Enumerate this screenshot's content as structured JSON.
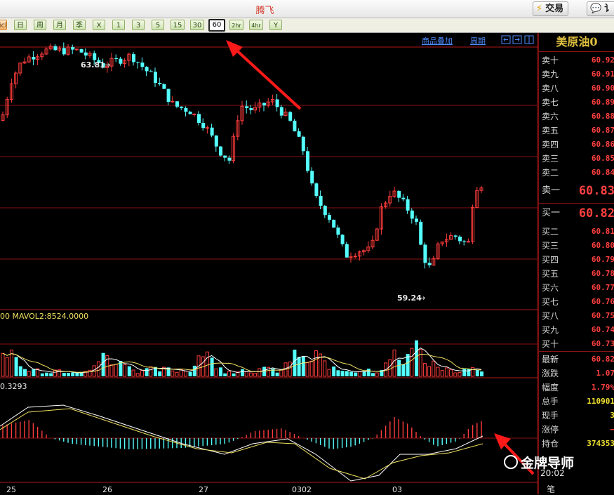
{
  "window": {
    "title": "腾飞",
    "trade_button": "交易",
    "chat_button": "讠"
  },
  "period_bar": {
    "buttons": [
      "lick",
      "日",
      "周",
      "月",
      "季",
      "X",
      "1",
      "3",
      "5",
      "15",
      "30",
      "60",
      "2hr",
      "4hr",
      "Y"
    ],
    "active": "60"
  },
  "chart_header": {
    "overlay_link": "商品叠加",
    "period_link": "周期"
  },
  "price_chart": {
    "high_label": "63.81",
    "low_label": "59.24",
    "colors": {
      "up": "#ff3c3c",
      "down": "#54ffff",
      "grid": "#8a1010",
      "background": "#000000"
    }
  },
  "volume_panel": {
    "label": "00  MAVOL2:8524.0000"
  },
  "macd_panel": {
    "label": "0.3293"
  },
  "x_axis": {
    "ticks": [
      "25",
      "26",
      "27",
      "0302",
      "03"
    ]
  },
  "quote_panel": {
    "symbol": "美原油0",
    "asks": [
      {
        "label": "卖十",
        "value": "60.92"
      },
      {
        "label": "卖九",
        "value": "60.91"
      },
      {
        "label": "卖八",
        "value": "60.90"
      },
      {
        "label": "卖七",
        "value": "60.89"
      },
      {
        "label": "卖六",
        "value": "60.88"
      },
      {
        "label": "卖五",
        "value": "60.87"
      },
      {
        "label": "卖四",
        "value": "60.86"
      },
      {
        "label": "卖三",
        "value": "60.85"
      },
      {
        "label": "卖二",
        "value": "60.84"
      },
      {
        "label": "卖一",
        "value": "60.83"
      }
    ],
    "bids": [
      {
        "label": "买一",
        "value": "60.82"
      },
      {
        "label": "买二",
        "value": "60.81"
      },
      {
        "label": "买三",
        "value": "60.80"
      },
      {
        "label": "买四",
        "value": "60.79"
      },
      {
        "label": "买五",
        "value": "60.78"
      },
      {
        "label": "买六",
        "value": "60.77"
      },
      {
        "label": "买七",
        "value": "60.76"
      },
      {
        "label": "买八",
        "value": "60.75"
      },
      {
        "label": "买九",
        "value": "60.74"
      },
      {
        "label": "买十",
        "value": "60.73"
      }
    ],
    "stats": [
      {
        "label": "最新",
        "value": "60.82"
      },
      {
        "label": "涨跌",
        "value": "1.07"
      },
      {
        "label": "幅度",
        "value": "1.79%"
      },
      {
        "label": "总手",
        "value": "110901"
      },
      {
        "label": "现手",
        "value": "3"
      },
      {
        "label": "涨停",
        "value": "—"
      },
      {
        "label": "持仓",
        "value": "374353"
      }
    ],
    "time": "20:02",
    "bottom_label": "笔"
  },
  "watermark": "金牌导师"
}
